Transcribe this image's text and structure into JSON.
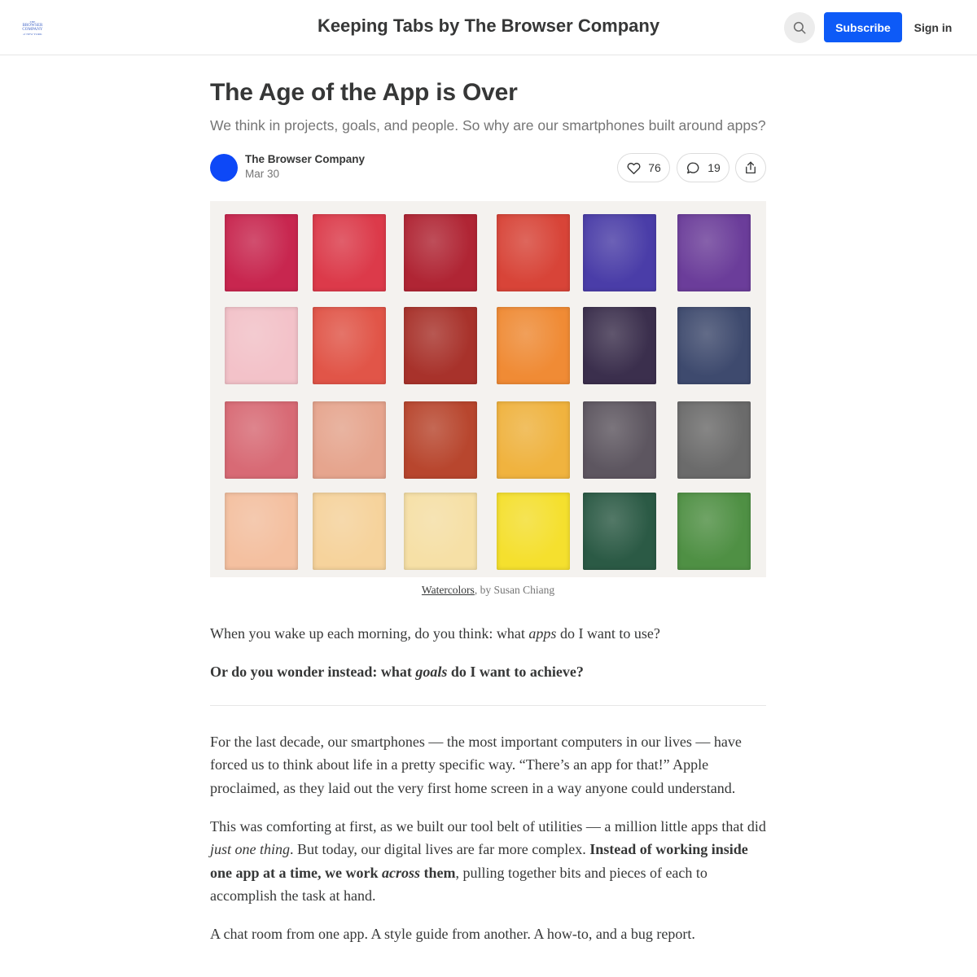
{
  "header": {
    "logo_lines": [
      "THE",
      "BROWSER",
      "COMPANY",
      "of NEW YORK"
    ],
    "publication_title": "Keeping Tabs by The Browser Company",
    "search_icon": "search-icon",
    "subscribe_label": "Subscribe",
    "signin_label": "Sign in",
    "accent_color": "#0d5af7"
  },
  "post": {
    "title": "The Age of the App is Over",
    "subtitle": "We think in projects, goals, and people. So why are our smartphones built around apps?",
    "author": "The Browser Company",
    "date": "Mar 30",
    "like_count": "76",
    "comment_count": "19",
    "icons": [
      "heart-icon",
      "comment-icon",
      "share-icon"
    ]
  },
  "hero_image": {
    "description_colors": [
      [
        "#c8264f",
        "#dc3a4a",
        "#b02534",
        "#d84438",
        "#4a3da8",
        "#6b3d9a"
      ],
      [
        "#f3c2c9",
        "#e15548",
        "#a8322b",
        "#f08b35",
        "#3b2f4d",
        "#3e4a6e"
      ],
      [
        "#d86a75",
        "#e6a58e",
        "#b8462e",
        "#f0b33f",
        "#5d5660",
        "#6b6b6b"
      ],
      [
        "#f4c0a0",
        "#f6d39c",
        "#f6e0a6",
        "#f5e02e",
        "#2b5a45",
        "#4f9044"
      ]
    ],
    "caption_link": "Watercolors",
    "caption_rest": ", by Susan Chiang"
  },
  "body": {
    "p1_a": "When you wake up each morning, do you think: what ",
    "p1_em": "apps",
    "p1_b": " do I want to use?",
    "p2_a": "Or do you wonder instead: what ",
    "p2_em": "goals",
    "p2_b": " do I want to achieve?",
    "p3": "For the last decade, our smartphones — the most important computers in our lives — have forced us to think about life in a pretty specific way. “There’s an app for that!” Apple proclaimed, as they laid out the very first home screen in a way anyone could understand.",
    "p4_a": "This was comforting at first, as we built our tool belt of utilities — a million little apps that did ",
    "p4_em": "just one thing",
    "p4_b": ". But today, our digital lives are far more complex. ",
    "p4_strong_a": "Instead of working inside one app at a time, we work ",
    "p4_strong_em": "across",
    "p4_strong_b": " them",
    "p4_c": ", pulling together bits and pieces of each to accomplish the task at hand.",
    "p5": "A chat room from one app. A style guide from another. A how-to, and a bug report."
  }
}
